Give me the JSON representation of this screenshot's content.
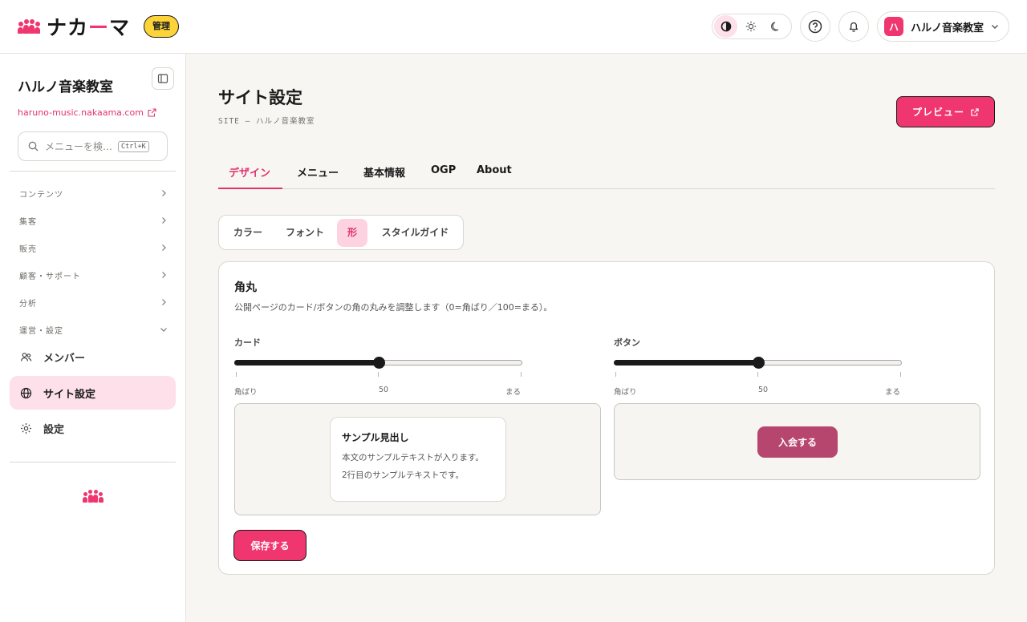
{
  "header": {
    "brand_name_a": "ナカ",
    "brand_name_b": "ー",
    "brand_name_c": "マ",
    "admin_badge": "管理",
    "account_name": "ハルノ音楽教室",
    "account_initial": "ハ",
    "theme_modes": [
      "contrast-icon",
      "sun-icon",
      "moon-icon"
    ],
    "theme_active": "contrast"
  },
  "sidebar": {
    "org_name": "ハルノ音楽教室",
    "org_url": "haruno-music.nakaama.com",
    "search_placeholder": "メニューを検…",
    "search_shortcut": "Ctrl+K",
    "sections": [
      {
        "label": "コンテンツ",
        "expanded": false
      },
      {
        "label": "集客",
        "expanded": false
      },
      {
        "label": "販売",
        "expanded": false
      },
      {
        "label": "顧客・サポート",
        "expanded": false
      },
      {
        "label": "分析",
        "expanded": false
      },
      {
        "label": "運営・設定",
        "expanded": true
      }
    ],
    "items": [
      {
        "label": "メンバー",
        "icon": "members-icon",
        "active": false
      },
      {
        "label": "サイト設定",
        "icon": "globe-icon",
        "active": true
      },
      {
        "label": "設定",
        "icon": "gear-icon",
        "active": false
      }
    ]
  },
  "main": {
    "title": "サイト設定",
    "subtitle": "SITE — ハルノ音楽教室",
    "preview_label": "プレビュー",
    "tabs": [
      "デザイン",
      "メニュー",
      "基本情報",
      "OGP",
      "About"
    ],
    "active_tab": "デザイン",
    "subtabs": [
      "カラー",
      "フォント",
      "形",
      "スタイルガイド"
    ],
    "active_subtab": "形"
  },
  "radius": {
    "title": "角丸",
    "description": "公開ページのカード/ボタンの角の丸みを調整します（0=角ばり／100=まる）。",
    "card": {
      "label": "カード",
      "value": 50,
      "min_label": "角ばり",
      "mid_label": "50",
      "max_label": "まる"
    },
    "button": {
      "label": "ボタン",
      "value": 50,
      "min_label": "角ばり",
      "mid_label": "50",
      "max_label": "まる"
    },
    "sample_heading": "サンプル見出し",
    "sample_text_1": "本文のサンプルテキストが入ります。",
    "sample_text_2": "2行目のサンプルテキストです。",
    "sample_button": "入会する",
    "save_label": "保存する"
  },
  "colors": {
    "accent": "#f0366f",
    "accent_soft": "#fde0ea",
    "badge": "#fcd43a",
    "sample_button": "#b7466e"
  }
}
